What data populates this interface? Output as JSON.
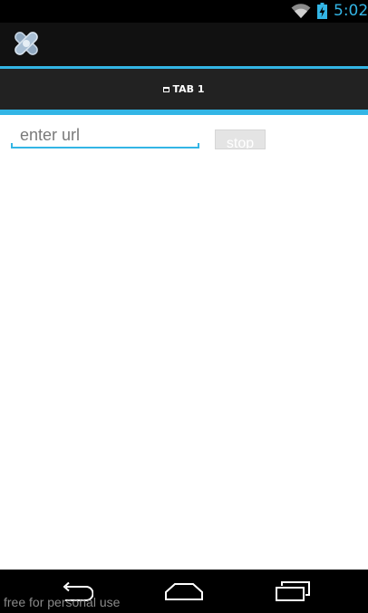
{
  "status_bar": {
    "time": "5:02",
    "icons": [
      "wifi-icon",
      "battery-charging-icon"
    ]
  },
  "action_bar": {
    "app_icon": "app-logo-icon"
  },
  "tabs": [
    {
      "label": "TAB 1",
      "icon": "tab-icon",
      "selected": true
    }
  ],
  "content": {
    "url_input": {
      "placeholder": "enter url",
      "value": ""
    },
    "stop_button": {
      "label": "stop"
    }
  },
  "nav_bar": {
    "buttons": [
      "back-icon",
      "home-icon",
      "recents-icon"
    ]
  },
  "watermark": "free for personal use",
  "colors": {
    "accent": "#33b5e5",
    "status_bar": "#000000",
    "action_bar": "#111111",
    "tab_bar": "#222222",
    "background": "#ffffff"
  }
}
